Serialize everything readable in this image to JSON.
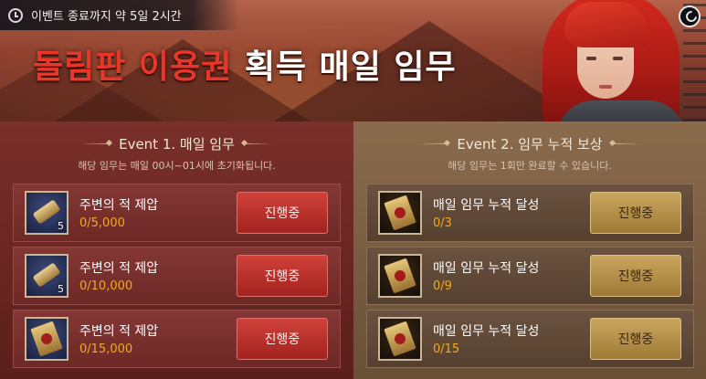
{
  "banner": {
    "timer_text": "이벤트 종료까지 약 5일 2시간",
    "title_red": "돌림판 이용권",
    "title_white": "획득 매일 임무"
  },
  "event1": {
    "title": "Event 1. 매일 임무",
    "subtitle": "해당 임무는 매일 00시~01시에 초기화됩니다.",
    "rows": [
      {
        "name": "주변의 적 제압",
        "progress": "0/5,000",
        "count": "5",
        "button": "진행중"
      },
      {
        "name": "주변의 적 제압",
        "progress": "0/10,000",
        "count": "5",
        "button": "진행중"
      },
      {
        "name": "주변의 적 제압",
        "progress": "0/15,000",
        "count": "",
        "button": "진행중"
      }
    ]
  },
  "event2": {
    "title": "Event 2. 임무 누적 보상",
    "subtitle": "해당 임무는 1회만 완료할 수 있습니다.",
    "rows": [
      {
        "name": "매일 임무 누적 달성",
        "progress": "0/3",
        "button": "진행중"
      },
      {
        "name": "매일 임무 누적 달성",
        "progress": "0/9",
        "button": "진행중"
      },
      {
        "name": "매일 임무 누적 달성",
        "progress": "0/15",
        "button": "진행중"
      }
    ]
  },
  "colors": {
    "progress": "#f0a825",
    "title_red": "#e8372a",
    "left_button": "#b32d28",
    "right_button": "#b8944c"
  },
  "icons": [
    "clock-icon",
    "close-icon",
    "scroll-item-icon",
    "coupon-item-icon"
  ]
}
